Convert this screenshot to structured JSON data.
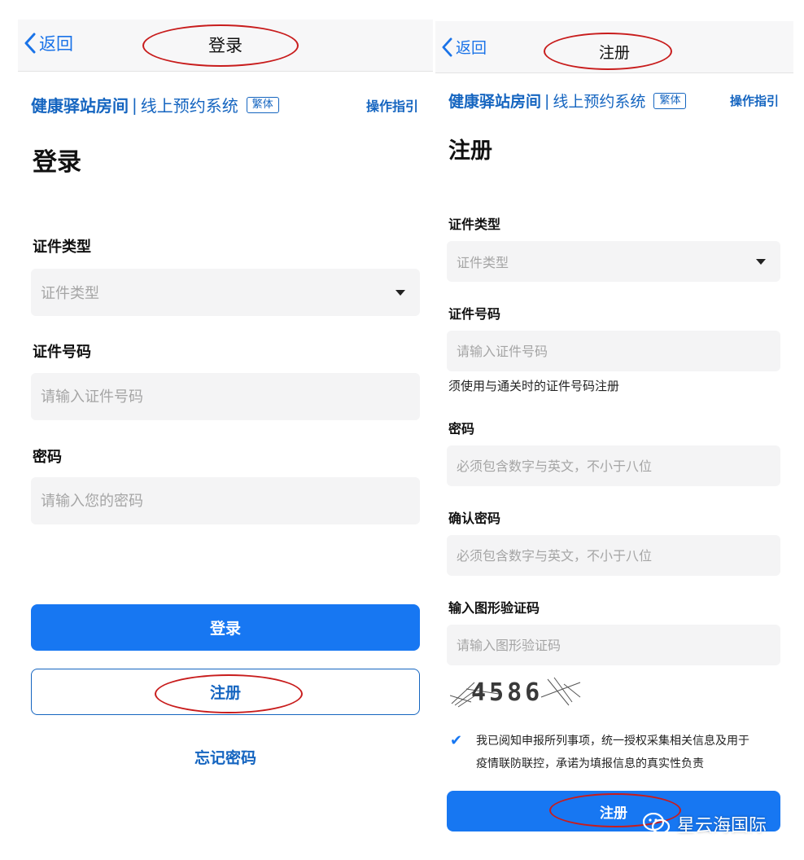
{
  "colors": {
    "accent": "#1777f2",
    "brand_blue": "#1565c0",
    "annotation_red": "#c81c1c"
  },
  "left": {
    "back_label": "返回",
    "nav_title": "登录",
    "brand": "健康驿站房间",
    "brand_sep": "|",
    "brand_sub": "线上预约系统",
    "trad_label": "繁体",
    "guide_label": "操作指引",
    "heading": "登录",
    "id_type_label": "证件类型",
    "id_type_placeholder": "证件类型",
    "id_number_label": "证件号码",
    "id_number_placeholder": "请输入证件号码",
    "password_label": "密码",
    "password_placeholder": "请输入您的密码",
    "login_button": "登录",
    "register_button": "注册",
    "forgot_link": "忘记密码"
  },
  "right": {
    "back_label": "返回",
    "nav_title": "注册",
    "brand": "健康驿站房间",
    "brand_sep": "|",
    "brand_sub": "线上预约系统",
    "trad_label": "繁体",
    "guide_label": "操作指引",
    "heading": "注册",
    "id_type_label": "证件类型",
    "id_type_placeholder": "证件类型",
    "id_number_label": "证件号码",
    "id_number_placeholder": "请输入证件号码",
    "id_number_hint": "须使用与通关时的证件号码注册",
    "password_label": "密码",
    "password_placeholder": "必须包含数字与英文，不小于八位",
    "confirm_label": "确认密码",
    "confirm_placeholder": "必须包含数字与英文，不小于八位",
    "captcha_label": "输入图形验证码",
    "captcha_placeholder": "请输入图形验证码",
    "captcha_value": "4586",
    "agree_text_1": "我已阅知申报所列事项，统一授权采集相关信息及用于",
    "agree_text_2": "疫情联防联控，承诺为填报信息的真实性负责",
    "register_button": "注册"
  },
  "watermark": {
    "text": "星云海国际",
    "icon": "wechat-icon"
  }
}
